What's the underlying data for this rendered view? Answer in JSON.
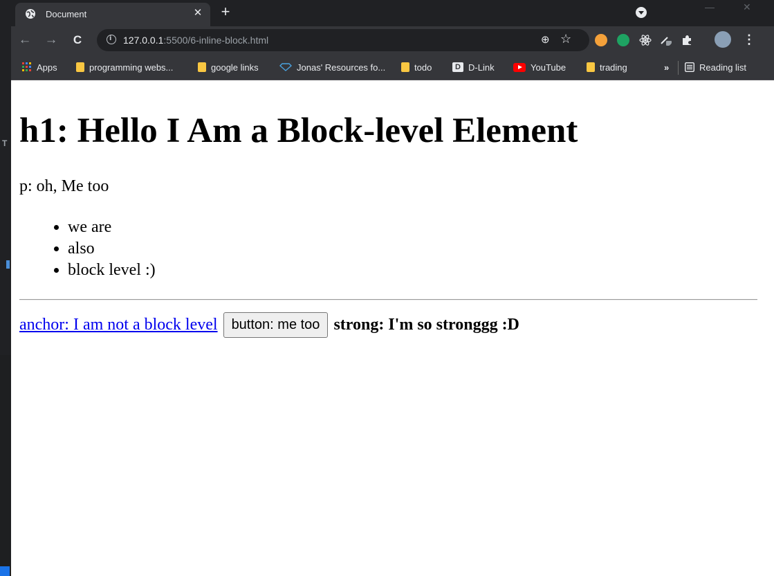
{
  "browser": {
    "tab": {
      "title": "Document",
      "close": "✕"
    },
    "new_tab": "+",
    "window_controls": {
      "minimize": "—",
      "close": "✕"
    },
    "nav": {
      "back": "←",
      "forward": "→",
      "reload": "C"
    },
    "url": {
      "host": "127.0.0.1",
      "path": ":5500/6-inline-block.html"
    },
    "omnibox_icons": {
      "zoom": "⊕",
      "bookmark": "☆"
    },
    "menu": "⋮",
    "bookmarks": [
      {
        "label": "Apps",
        "icon": "apps-grid-icon"
      },
      {
        "label": "programming webs...",
        "icon": "folder-icon"
      },
      {
        "label": "google links",
        "icon": "folder-icon"
      },
      {
        "label": "Jonas' Resources fo...",
        "icon": "diamond-icon"
      },
      {
        "label": "todo",
        "icon": "folder-icon"
      },
      {
        "label": "D-Link",
        "icon": "dlink-icon"
      },
      {
        "label": "YouTube",
        "icon": "youtube-icon"
      },
      {
        "label": "trading",
        "icon": "folder-icon"
      }
    ],
    "more": "»",
    "reading_list": "Reading list",
    "colors": {
      "chrome_dark": "#202124",
      "chrome_toolbar": "#35363a",
      "link": "#0000ee"
    }
  },
  "page": {
    "h1": "h1: Hello I Am a Block-level Element",
    "p": "p: oh, Me too",
    "list": [
      "we are",
      "also",
      "block level :)"
    ],
    "anchor": "anchor: I am not a block level",
    "button": "button: me too",
    "strong": "strong: I'm so stronggg :D"
  }
}
